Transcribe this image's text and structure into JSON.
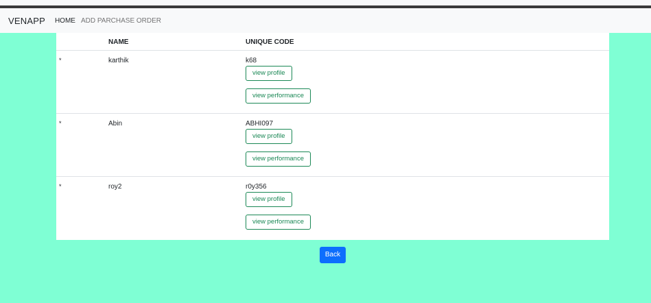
{
  "navbar": {
    "brand": "VENAPP",
    "links": [
      {
        "label": "HOME"
      },
      {
        "label": "ADD PARCHASE ORDER"
      }
    ]
  },
  "table": {
    "headers": {
      "name": "NAME",
      "code": "UNIQUE CODE"
    },
    "rows": [
      {
        "bullet": "*",
        "name": "karthik",
        "code": "k68"
      },
      {
        "bullet": "*",
        "name": "Abin",
        "code": "ABHI097"
      },
      {
        "bullet": "*",
        "name": "roy2",
        "code": "r0y356"
      }
    ],
    "view_profile_label": "view profile",
    "view_performance_label": "view performance"
  },
  "back_label": "Back",
  "colors": {
    "background": "#7fffd4",
    "primary": "#0d6efd",
    "success": "#198754"
  }
}
